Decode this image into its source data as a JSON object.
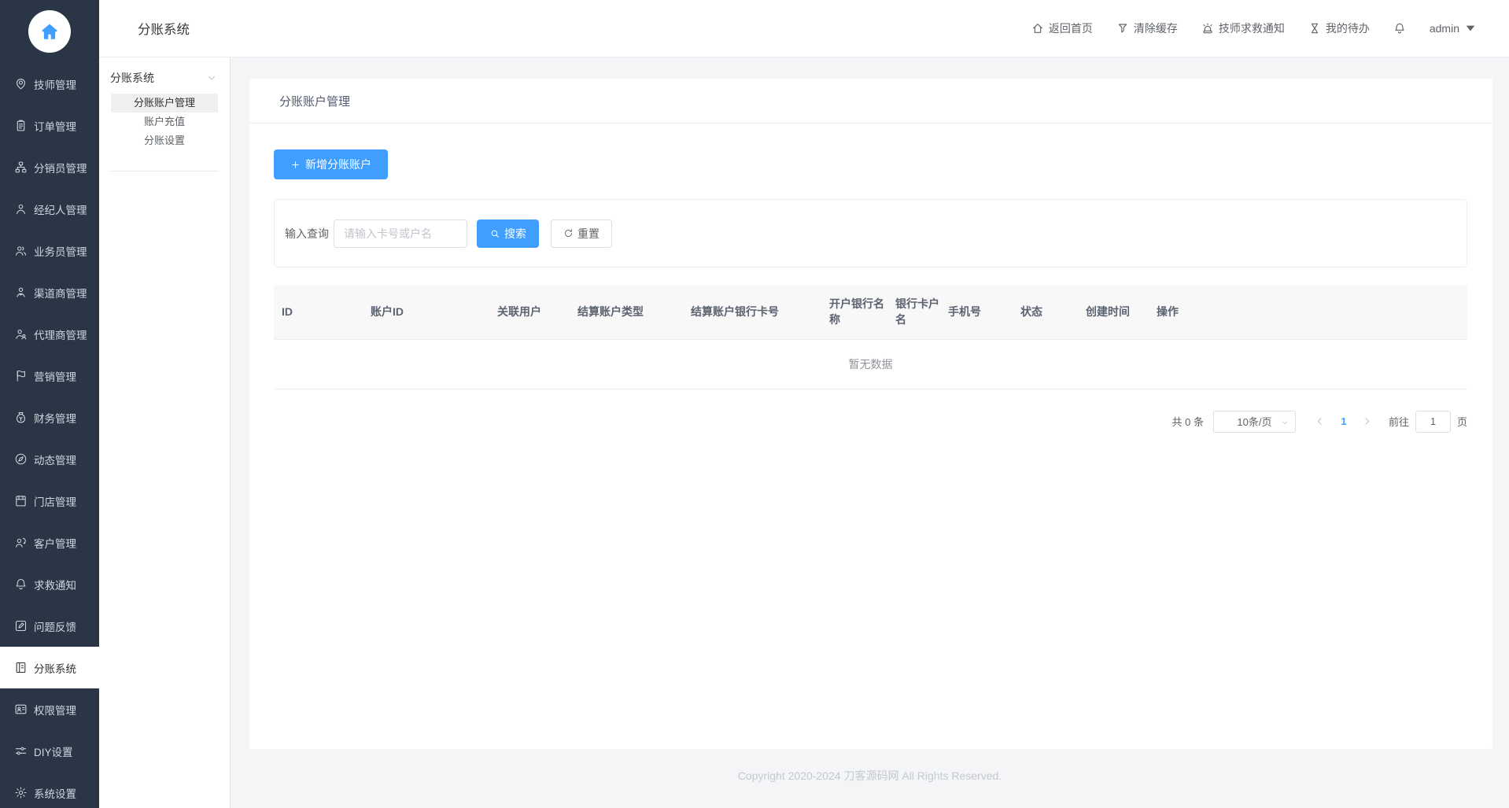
{
  "header": {
    "title": "分账系统",
    "nav": [
      {
        "label": "返回首页",
        "icon": "home-icon"
      },
      {
        "label": "清除缓存",
        "icon": "clear-cache-icon"
      },
      {
        "label": "技师求救通知",
        "icon": "siren-icon"
      },
      {
        "label": "我的待办",
        "icon": "hourglass-icon"
      }
    ],
    "user": "admin"
  },
  "sidebar": {
    "items": [
      {
        "label": "技师管理",
        "icon": "technician-icon"
      },
      {
        "label": "订单管理",
        "icon": "order-icon"
      },
      {
        "label": "分销员管理",
        "icon": "distributor-icon"
      },
      {
        "label": "经纪人管理",
        "icon": "broker-icon"
      },
      {
        "label": "业务员管理",
        "icon": "salesman-icon"
      },
      {
        "label": "渠道商管理",
        "icon": "channel-icon"
      },
      {
        "label": "代理商管理",
        "icon": "agent-icon"
      },
      {
        "label": "营销管理",
        "icon": "marketing-icon"
      },
      {
        "label": "财务管理",
        "icon": "finance-icon"
      },
      {
        "label": "动态管理",
        "icon": "activity-icon"
      },
      {
        "label": "门店管理",
        "icon": "store-icon"
      },
      {
        "label": "客户管理",
        "icon": "customer-icon"
      },
      {
        "label": "求救通知",
        "icon": "sos-bell-icon"
      },
      {
        "label": "问题反馈",
        "icon": "feedback-icon"
      },
      {
        "label": "分账系统",
        "icon": "ledger-icon",
        "active": true
      },
      {
        "label": "权限管理",
        "icon": "permission-icon"
      },
      {
        "label": "DIY设置",
        "icon": "diy-icon"
      },
      {
        "label": "系统设置",
        "icon": "settings-icon"
      }
    ]
  },
  "submenu": {
    "group_label": "分账系统",
    "items": [
      {
        "label": "分账账户管理",
        "active": true
      },
      {
        "label": "账户充值"
      },
      {
        "label": "分账设置"
      }
    ]
  },
  "page": {
    "card_title": "分账账户管理",
    "add_button_label": "新增分账账户",
    "search": {
      "label": "输入查询",
      "placeholder": "请输入卡号或户名",
      "search_label": "搜索",
      "reset_label": "重置"
    },
    "table": {
      "columns": [
        "ID",
        "账户ID",
        "关联用户",
        "结算账户类型",
        "结算账户银行卡号",
        "开户银行名称",
        "银行卡户名",
        "手机号",
        "状态",
        "创建时间",
        "操作"
      ],
      "empty_text": "暂无数据"
    },
    "pagination": {
      "total": "共 0 条",
      "page_size": "10条/页",
      "current_page": "1",
      "goto_label": "前往",
      "goto_value": "1",
      "unit_label": "页"
    }
  },
  "footer": {
    "copyright": "Copyright 2020-2024 刀客源码网 All Rights Reserved."
  },
  "colors": {
    "primary": "#409eff",
    "sidebar_bg": "#2a3646",
    "page_bg": "#f4f5f7"
  }
}
